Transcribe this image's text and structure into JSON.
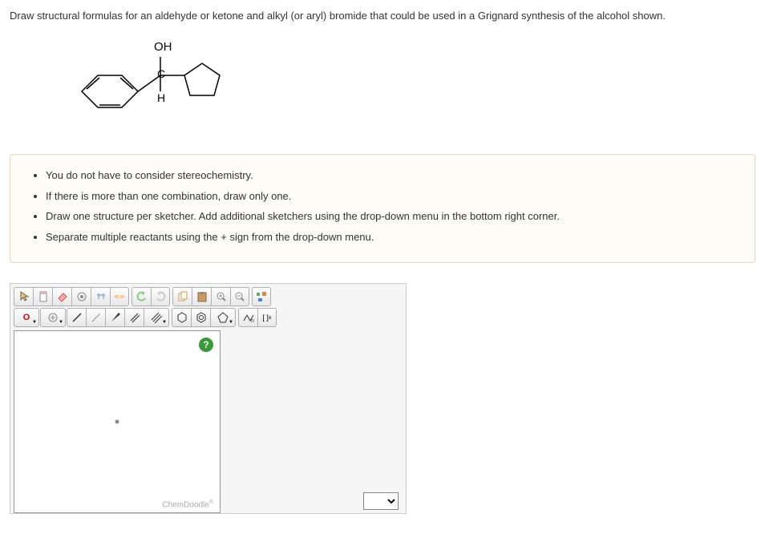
{
  "question": "Draw structural formulas for an aldehyde or ketone and alkyl (or aryl) bromide that could be used in a Grignard synthesis of the alcohol shown.",
  "structure_labels": {
    "oh": "OH",
    "c": "C",
    "h": "H"
  },
  "hints": [
    "You do not have to consider stereochemistry.",
    "If there is more than one combination, draw only one.",
    "Draw one structure per sketcher. Add additional sketchers using the drop-down menu in the bottom right corner.",
    "Separate multiple reactants using the + sign from the drop-down menu."
  ],
  "toolbar": {
    "element": "O",
    "chemdoodle": "ChemDoodle",
    "help": "?",
    "charge_btn": "[ ]",
    "charge_sup": "±"
  }
}
